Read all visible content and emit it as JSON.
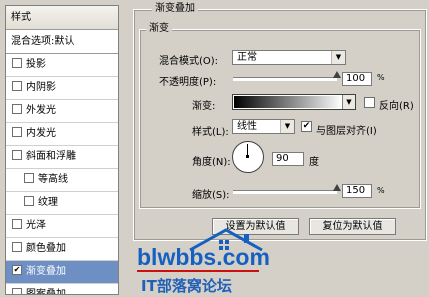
{
  "styles_panel": {
    "header": "样式",
    "blend_options": "混合选项:默认",
    "items": [
      {
        "label": "投影",
        "checked": false,
        "indent": false,
        "selected": false
      },
      {
        "label": "内阴影",
        "checked": false,
        "indent": false,
        "selected": false
      },
      {
        "label": "外发光",
        "checked": false,
        "indent": false,
        "selected": false
      },
      {
        "label": "内发光",
        "checked": false,
        "indent": false,
        "selected": false
      },
      {
        "label": "斜面和浮雕",
        "checked": false,
        "indent": false,
        "selected": false
      },
      {
        "label": "等高线",
        "checked": false,
        "indent": true,
        "selected": false
      },
      {
        "label": "纹理",
        "checked": false,
        "indent": true,
        "selected": false
      },
      {
        "label": "光泽",
        "checked": false,
        "indent": false,
        "selected": false
      },
      {
        "label": "颜色叠加",
        "checked": false,
        "indent": false,
        "selected": false
      },
      {
        "label": "渐变叠加",
        "checked": true,
        "indent": false,
        "selected": true
      },
      {
        "label": "图案叠加",
        "checked": false,
        "indent": false,
        "selected": false
      }
    ]
  },
  "gradient_overlay": {
    "group_title": "渐变叠加",
    "subgroup_title": "渐变",
    "blend_mode_label": "混合模式(O):",
    "blend_mode_value": "正常",
    "opacity_label": "不透明度(P):",
    "opacity_value": "100",
    "opacity_fraction": 1.0,
    "percent_sign": "%",
    "gradient_label": "渐变:",
    "reverse_label": "反向(R)",
    "reverse_checked": false,
    "style_label": "样式(L):",
    "style_value": "线性",
    "align_label": "与图层对齐(I)",
    "align_checked": true,
    "angle_label": "角度(N):",
    "angle_value": "90",
    "angle_unit": "度",
    "scale_label": "缩放(S):",
    "scale_value": "150",
    "scale_fraction": 1.0,
    "default_button": "设置为默认值",
    "reset_button": "复位为默认值"
  },
  "watermark": {
    "site": "blwbbs.com",
    "caption": "IT部落窝论坛",
    "site_color": "#1560c0",
    "caption_color": "#2060b8"
  }
}
